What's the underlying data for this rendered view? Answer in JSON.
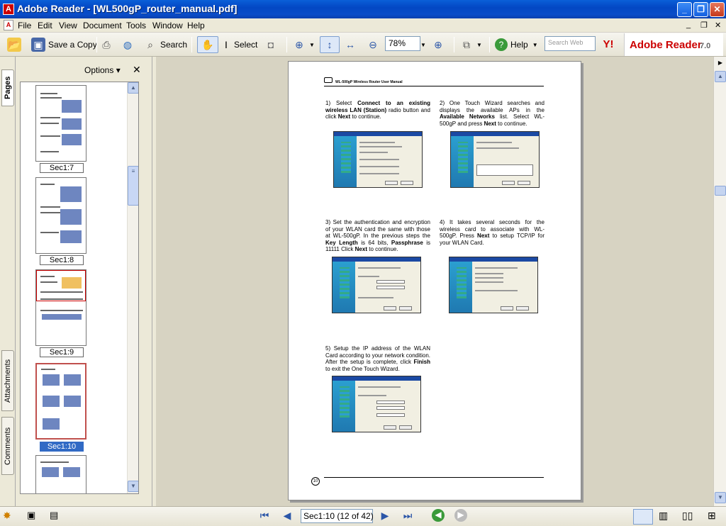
{
  "window": {
    "title": "Adobe Reader - [WL500gP_router_manual.pdf]"
  },
  "menus": [
    "File",
    "Edit",
    "View",
    "Document",
    "Tools",
    "Window",
    "Help"
  ],
  "toolbar": {
    "save_copy": "Save a Copy",
    "search": "Search",
    "select": "Select",
    "zoom": "78%",
    "help": "Help",
    "search_web_placeholder": "Search Web",
    "brand": "Adobe Reader",
    "version": "7.0"
  },
  "panel": {
    "options": "Options",
    "tabs": {
      "pages": "Pages",
      "attachments": "Attachments",
      "comments": "Comments"
    },
    "thumbnails": [
      {
        "label": "Sec1:7"
      },
      {
        "label": "Sec1:8"
      },
      {
        "label": "Sec1:9"
      },
      {
        "label": "Sec1:10",
        "selected": true
      }
    ]
  },
  "page": {
    "header": "WL-500gP Wireless Router User Manual",
    "page_number": "10",
    "steps": [
      {
        "parts": [
          [
            "1) Select ",
            ""
          ],
          [
            "Connect to an existing wireless LAN (Station)",
            "b"
          ],
          [
            " radio button and click ",
            ""
          ],
          [
            "Next",
            "b"
          ],
          [
            " to continue.",
            ""
          ]
        ]
      },
      {
        "parts": [
          [
            "2) One Touch Wizard searches and displays the available APs in the ",
            ""
          ],
          [
            "Available Networks",
            "b"
          ],
          [
            " list. Select WL-500gP and press ",
            ""
          ],
          [
            "Next",
            "b"
          ],
          [
            " to continue.",
            ""
          ]
        ]
      },
      {
        "parts": [
          [
            "3) Set the authentication and encryption of your WLAN card the same with those at WL-500gP. In the previous steps the ",
            ""
          ],
          [
            "Key Length",
            "b"
          ],
          [
            " is ",
            ""
          ],
          [
            "64 bits",
            ""
          ],
          [
            ", ",
            ""
          ],
          [
            "Passphrase",
            "b"
          ],
          [
            " is 11111 Click ",
            ""
          ],
          [
            "Next",
            "b"
          ],
          [
            " to continue.",
            ""
          ]
        ]
      },
      {
        "parts": [
          [
            "4) It takes several seconds for the wireless card to associate with WL-500gP. Press ",
            ""
          ],
          [
            "Next",
            "b"
          ],
          [
            " to setup TCP/IP for your WLAN Card.",
            ""
          ]
        ]
      },
      {
        "parts": [
          [
            "5) Setup the IP address of the WLAN Card according to your network condition. After the setup is complete, click ",
            ""
          ],
          [
            "Finish",
            "b"
          ],
          [
            " to exit the One Touch Wizard.",
            ""
          ]
        ]
      }
    ]
  },
  "status": {
    "page_field": "Sec1:10  (12 of 42)"
  }
}
